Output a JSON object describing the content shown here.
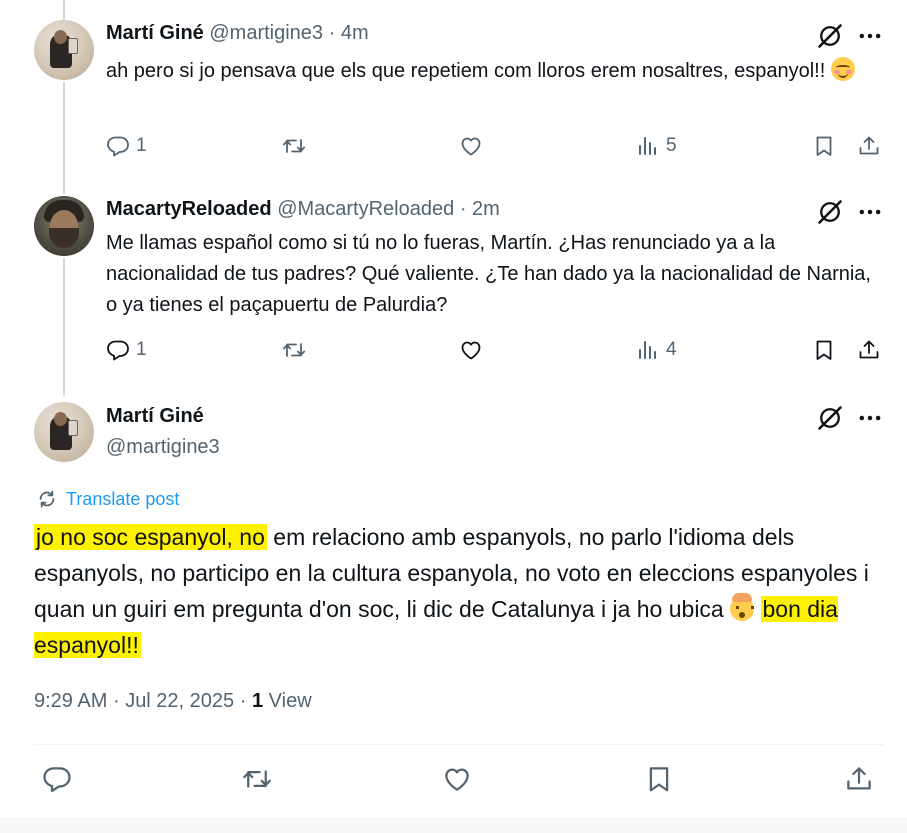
{
  "tweet1": {
    "name": "Martí Giné",
    "handle": "@martigine3",
    "sep": "·",
    "time": "4m",
    "text": "ah pero si jo pensava que els que repetiem com lloros erem nosaltres, espanyol!!",
    "replies": "1",
    "views": "5"
  },
  "tweet2": {
    "name": "MacartyReloaded",
    "handle": "@MacartyReloaded",
    "sep": "·",
    "time": "2m",
    "text": "Me llamas español como si tú no lo fueras, Martín. ¿Has renunciado ya a la nacionalidad de tus padres? Qué valiente. ¿Te han dado ya la nacionalidad de Narnia, o ya tienes el paçapuertu de Palurdia?",
    "replies": "1",
    "views": "4"
  },
  "main": {
    "name": "Martí Giné",
    "handle": "@martigine3",
    "translate": "Translate post",
    "text_hl1": "jo no soc espanyol, no",
    "text_mid": " em relaciono amb espanyols, no parlo l'idioma dels espanyols, no participo en la cultura espanyola, no voto en eleccions espanyoles i quan un guiri em pregunta d'on soc, li dic de Catalunya i ja ho ubica ",
    "text_hl2": "bon dia espanyol!!",
    "time": "9:29 AM",
    "dot1": "·",
    "date": "Jul 22, 2025",
    "dot2": "·",
    "view_count": "1",
    "view_label": "View"
  },
  "colors": {
    "accent": "#1d9bf0",
    "muted": "#536471",
    "highlight": "#fff200"
  },
  "icons": [
    "reply-icon",
    "retweet-icon",
    "like-icon",
    "views-icon",
    "bookmark-icon",
    "share-icon",
    "grok-icon",
    "more-icon",
    "translate-icon"
  ]
}
